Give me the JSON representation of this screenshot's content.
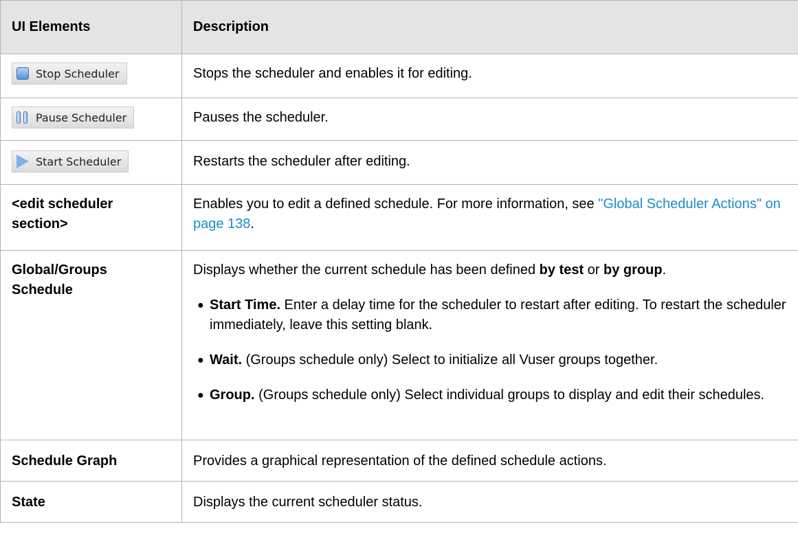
{
  "table": {
    "headers": [
      "UI Elements",
      "Description"
    ],
    "rows": {
      "stop": {
        "button_label": "Stop Scheduler",
        "button_icon": "stop-square-icon",
        "description": "Stops the scheduler and enables it for editing."
      },
      "pause": {
        "button_label": "Pause Scheduler",
        "button_icon": "pause-bars-icon",
        "description": "Pauses the scheduler."
      },
      "start": {
        "button_label": "Start Scheduler",
        "button_icon": "play-triangle-icon",
        "description": "Restarts the scheduler after editing."
      },
      "edit": {
        "element": "<edit scheduler section>",
        "description_prefix": "Enables you to edit a defined schedule. For more information, see ",
        "link_text": "\"Global Scheduler Actions\" on page 138",
        "description_suffix": "."
      },
      "global": {
        "element": "Global/Groups Schedule",
        "desc_part1": "Displays whether the current schedule has been defined ",
        "desc_bold1": "by test",
        "desc_part2": " or ",
        "desc_bold2": "by group",
        "desc_part3": ".",
        "bullets": [
          {
            "term": "Start Time.",
            "text": " Enter a delay time for the scheduler to restart after editing. To restart the scheduler immediately, leave this setting blank."
          },
          {
            "term": "Wait.",
            "text": " (Groups schedule only) Select to initialize all Vuser groups together."
          },
          {
            "term": "Group.",
            "text": " (Groups schedule only) Select individual groups to display and edit their schedules."
          }
        ]
      },
      "graph": {
        "element": "Schedule Graph",
        "description": "Provides a graphical representation of the defined schedule actions."
      },
      "state": {
        "element": "State",
        "description": "Displays the current scheduler status."
      }
    }
  },
  "colors": {
    "header_bg": "#e4e4e4",
    "border": "#b5b5b5",
    "link": "#1a8cc8"
  }
}
